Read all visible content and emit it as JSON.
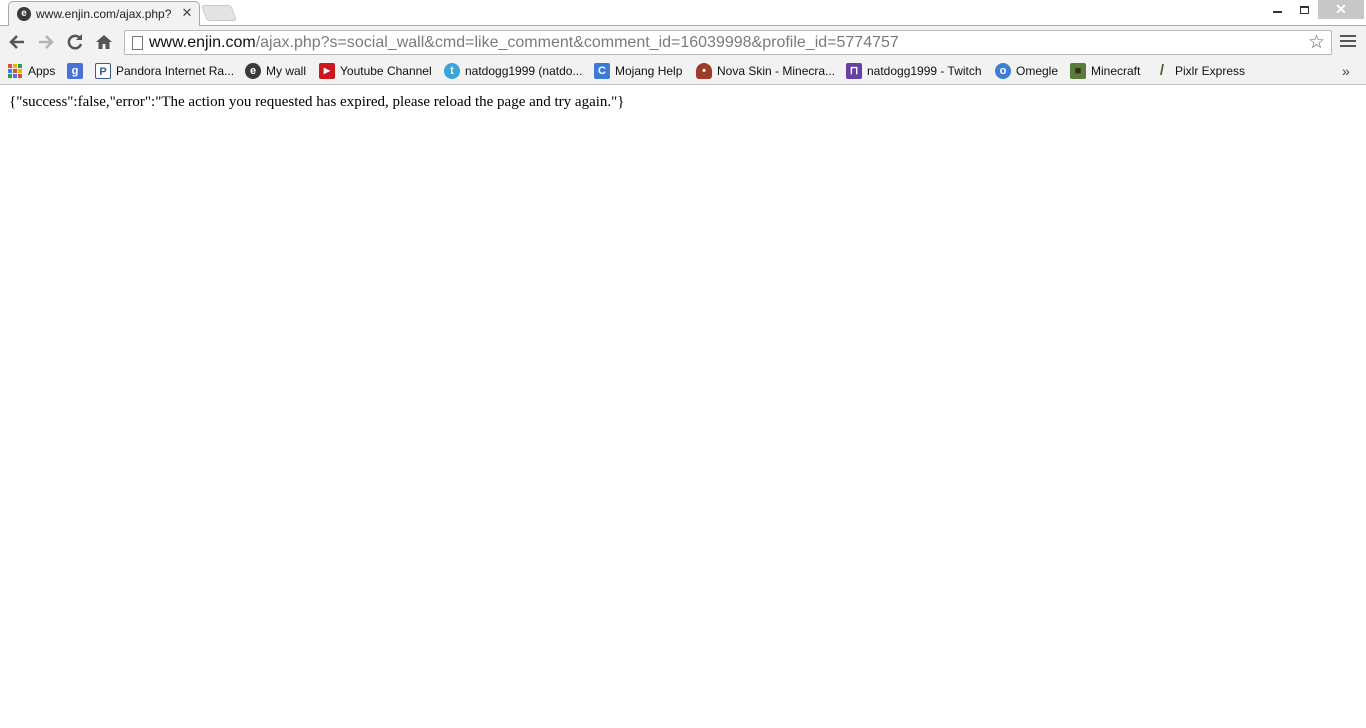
{
  "window": {
    "tab": {
      "title": "www.enjin.com/ajax.php?",
      "favicon": "enjin-icon"
    },
    "controls": {
      "minimize": "minimize-icon",
      "restore": "restore-icon",
      "close": "close-icon",
      "close_glyph": "✕"
    }
  },
  "toolbar": {
    "back_glyph": "🡐",
    "forward_glyph": "🡒",
    "reload_glyph": "⟳",
    "home_glyph": "⌂",
    "url_host": "www.enjin.com",
    "url_path": "/ajax.php?s=social_wall&cmd=like_comment&comment_id=16039998&profile_id=5774757",
    "star_glyph": "☆"
  },
  "bookmarks": {
    "items": [
      {
        "label": "Apps",
        "icon": "apps-grid-icon"
      },
      {
        "label": "",
        "icon": "google-plus-icon",
        "glyph": "g",
        "color": "#4a73d6"
      },
      {
        "label": "Pandora Internet Ra...",
        "icon": "pandora-icon",
        "glyph": "P",
        "color": "#3a5b8c"
      },
      {
        "label": "My wall",
        "icon": "enjin-icon",
        "glyph": "e",
        "color": "#3a3a3a"
      },
      {
        "label": "Youtube Channel",
        "icon": "youtube-icon",
        "glyph": "▶",
        "color": "#cc181e"
      },
      {
        "label": "natdogg1999 (natdo...",
        "icon": "twitter-icon",
        "glyph": "t",
        "color": "#39a4d8"
      },
      {
        "label": "Mojang Help",
        "icon": "mojang-help-icon",
        "glyph": "C",
        "color": "#3b7bd3"
      },
      {
        "label": "Nova Skin - Minecra...",
        "icon": "nova-skin-icon",
        "glyph": "•",
        "color": "#9b3b2a"
      },
      {
        "label": "natdogg1999 - Twitch",
        "icon": "twitch-icon",
        "glyph": "⊓",
        "color": "#6441a5"
      },
      {
        "label": "Omegle",
        "icon": "omegle-icon",
        "glyph": "o",
        "color": "#3d7fd4"
      },
      {
        "label": "Minecraft",
        "icon": "minecraft-icon",
        "glyph": "■",
        "color": "#5b7b3a"
      },
      {
        "label": "Pixlr Express",
        "icon": "pixlr-icon",
        "glyph": "/",
        "color": "#f2f2f2"
      }
    ],
    "more_glyph": "»"
  },
  "page": {
    "text": "{\"success\":false,\"error\":\"The action you requested has expired, please reload the page and try again.\"}"
  }
}
